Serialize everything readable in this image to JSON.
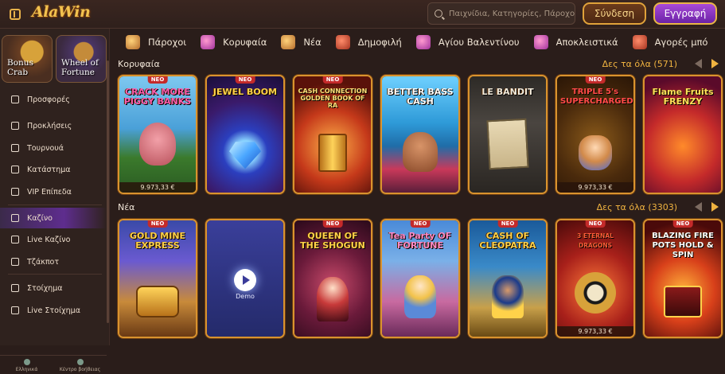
{
  "header": {
    "logo": "AlaWin",
    "search_placeholder": "Παιχνίδια, Κατηγορίες, Πάροχοι",
    "login": "Σύνδεση",
    "register": "Εγγραφή"
  },
  "sidebar": {
    "promos": [
      {
        "label": "Bonus Crab"
      },
      {
        "label": "Wheel of Fortune"
      }
    ],
    "items": [
      {
        "label": "Προσφορές",
        "icon": "gift-icon"
      },
      {
        "label": "Προκλήσεις",
        "icon": "medal-icon"
      },
      {
        "label": "Τουρνουά",
        "icon": "trophy-icon"
      },
      {
        "label": "Κατάστημα",
        "icon": "store-icon"
      },
      {
        "label": "VIP Επίπεδα",
        "icon": "diamond-icon"
      },
      {
        "label": "Καζίνο",
        "icon": "slot-icon"
      },
      {
        "label": "Live Καζίνο",
        "icon": "cards-icon"
      },
      {
        "label": "Τζάκποτ",
        "icon": "clover-icon"
      },
      {
        "label": "Στοίχημα",
        "icon": "ticket-icon"
      },
      {
        "label": "Live Στοίχημα",
        "icon": "live-icon"
      }
    ],
    "bottom_tabs": [
      "Ελληνικά",
      "Κέντρο βοήθειας"
    ]
  },
  "categories": [
    {
      "label": "Πάροχοι",
      "icon": "scroll-icon"
    },
    {
      "label": "Κορυφαία",
      "icon": "star-icon"
    },
    {
      "label": "Νέα",
      "icon": "lamp-icon"
    },
    {
      "label": "Δημοφιλή",
      "icon": "fire-icon"
    },
    {
      "label": "Αγίου Βαλεντίνου",
      "icon": "heart-icon"
    },
    {
      "label": "Αποκλειστικά",
      "icon": "potion-icon"
    },
    {
      "label": "Αγορές μπό",
      "icon": "chest-icon"
    }
  ],
  "sections": [
    {
      "title": "Κορυφαία",
      "see_all": "Δες τα όλα (571)",
      "games": [
        {
          "name": "CRACK MORE PIGGY BANKS",
          "badge": "ΝΕΟ",
          "price": "9.973,33 €"
        },
        {
          "name": "JEWEL BOOM",
          "badge": "ΝΕΟ",
          "price": ""
        },
        {
          "name": "CASH CONNECTION GOLDEN BOOK OF RA",
          "badge": "ΝΕΟ",
          "price": ""
        },
        {
          "name": "BETTER BASS CASH",
          "badge": "",
          "price": ""
        },
        {
          "name": "LE BANDIT",
          "badge": "",
          "price": ""
        },
        {
          "name": "TRIPLE 5's SUPERCHARGED",
          "badge": "ΝΕΟ",
          "price": "9.973,33 €"
        },
        {
          "name": "Flame Fruits FRENZY",
          "badge": "",
          "price": ""
        }
      ]
    },
    {
      "title": "Νέα",
      "see_all": "Δες τα όλα (3303)",
      "games": [
        {
          "name": "GOLD MINE EXPRESS",
          "badge": "ΝΕΟ",
          "price": ""
        },
        {
          "name": "",
          "badge": "",
          "price": "",
          "demo": "Demo"
        },
        {
          "name": "QUEEN OF THE SHOGUN",
          "badge": "ΝΕΟ",
          "price": ""
        },
        {
          "name": "Tea Party OF FORTUNE",
          "badge": "ΝΕΟ",
          "price": ""
        },
        {
          "name": "CASH OF CLEOPATRA",
          "badge": "ΝΕΟ",
          "price": ""
        },
        {
          "name": "3 ETERNAL DRAGONS",
          "badge": "ΝΕΟ",
          "price": "9.973,33 €"
        },
        {
          "name": "BLAZING FIRE POTS HOLD & SPIN",
          "badge": "ΝΕΟ",
          "price": ""
        }
      ]
    }
  ],
  "colors": {
    "accent": "#f0b340",
    "border": "#d9932e",
    "active_nav": "#5e2d8e"
  }
}
